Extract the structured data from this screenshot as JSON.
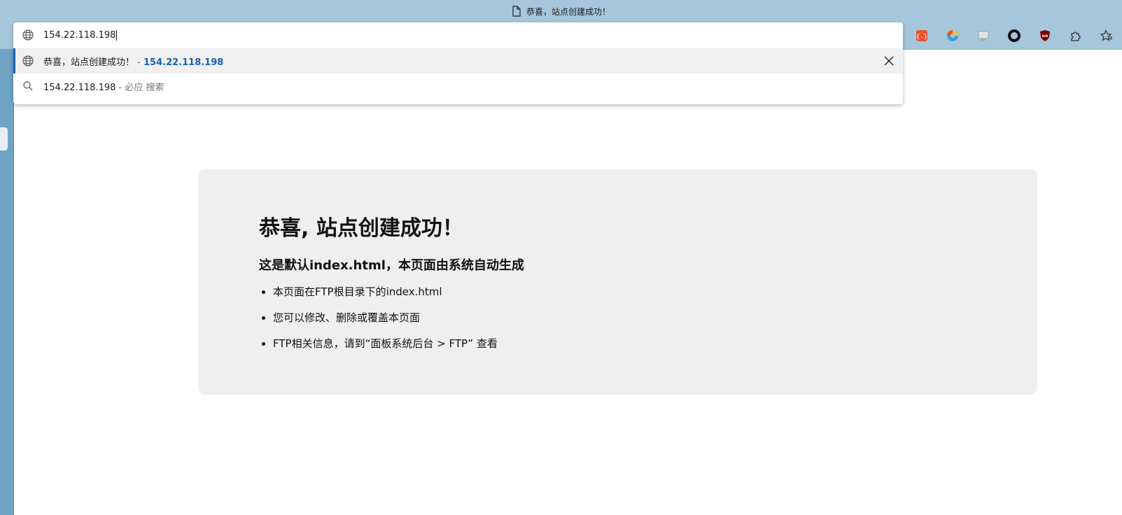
{
  "window": {
    "title": "恭喜，站点创建成功！"
  },
  "omnibox": {
    "input_value": "154.22.118.198",
    "suggestions": [
      {
        "title": "恭喜，站点创建成功！",
        "separator": "-",
        "url": "154.22.118.198"
      },
      {
        "query": "154.22.118.198",
        "suffix": "- 必应 搜索"
      }
    ]
  },
  "extensions": [
    {
      "icon": "json-viewer-icon",
      "color": "#e8532f"
    },
    {
      "icon": "color-wheel-icon",
      "color": "#3aa0d8"
    },
    {
      "icon": "screen-capture-icon",
      "color": "#b0b8c0"
    },
    {
      "icon": "dark-reader-icon",
      "color": "#111111"
    },
    {
      "icon": "ublock-origin-icon",
      "color": "#800000"
    },
    {
      "icon": "extensions-puzzle-icon",
      "color": "#333333"
    },
    {
      "icon": "favorites-star-icon",
      "color": "#333333"
    }
  ],
  "page": {
    "heading": "恭喜, 站点创建成功！",
    "subheading": "这是默认index.html，本页面由系统自动生成",
    "items": [
      "本页面在FTP根目录下的index.html",
      "您可以修改、删除或覆盖本页面",
      "FTP相关信息，请到“面板系统后台 > FTP” 查看"
    ]
  },
  "colors": {
    "chrome": "#a6c6dc",
    "accent": "#1a5fb4",
    "card_background": "#efefef"
  }
}
